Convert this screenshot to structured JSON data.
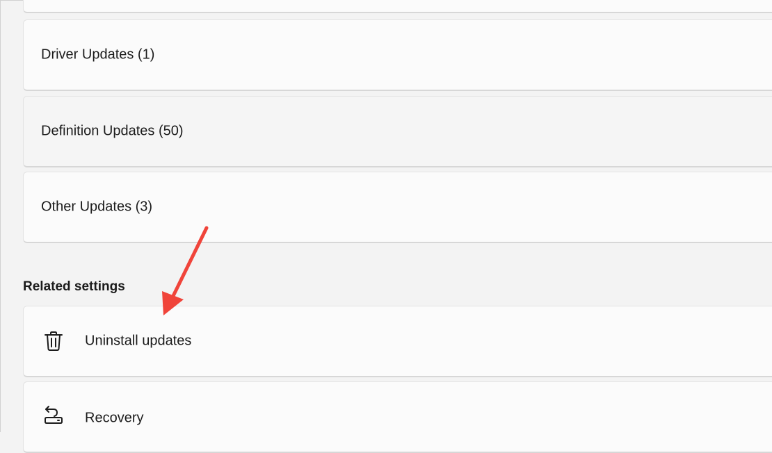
{
  "update_categories": [
    {
      "label": "Driver Updates (1)"
    },
    {
      "label": "Definition Updates (50)"
    },
    {
      "label": "Other Updates (3)"
    }
  ],
  "related_settings": {
    "heading": "Related settings",
    "items": [
      {
        "label": "Uninstall updates",
        "icon": "trash-icon"
      },
      {
        "label": "Recovery",
        "icon": "recovery-icon"
      }
    ]
  },
  "annotation": {
    "arrow_color": "#f0443a"
  }
}
